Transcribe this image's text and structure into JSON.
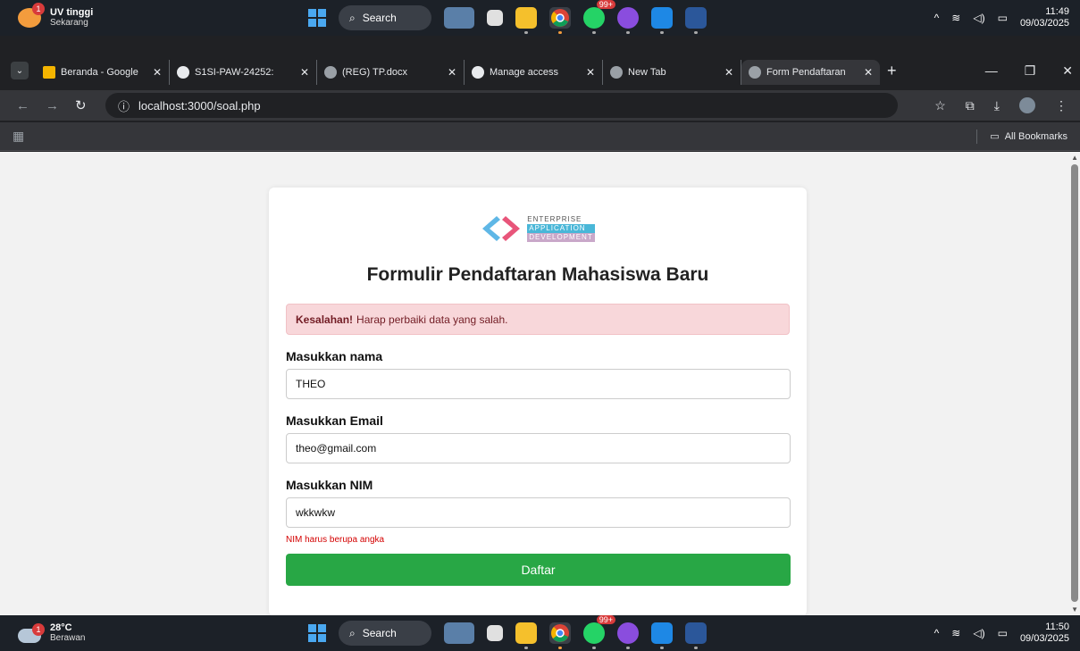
{
  "taskbar_top": {
    "notif_badge": "1",
    "notif_title": "UV tinggi",
    "notif_sub": "Sekarang",
    "search_label": "Search",
    "whatsapp_badge": "99+",
    "time": "11:49",
    "date": "09/03/2025"
  },
  "taskbar_bottom": {
    "weather_badge": "1",
    "temp": "28°C",
    "condition": "Berawan",
    "search_label": "Search",
    "whatsapp_badge": "99+",
    "time": "11:50",
    "date": "09/03/2025"
  },
  "tabs": [
    {
      "label": "Beranda - Google"
    },
    {
      "label": "S1SI-PAW-24252:"
    },
    {
      "label": "(REG) TP.docx"
    },
    {
      "label": "Manage access"
    },
    {
      "label": "New Tab"
    },
    {
      "label": "Form Pendaftaran"
    }
  ],
  "address": {
    "url": "localhost:3000/soal.php"
  },
  "bookmarks": {
    "all_label": "All Bookmarks"
  },
  "logo": {
    "line1": "ENTERPRISE",
    "line2": "APPLICATION",
    "line3": "DEVELOPMENT"
  },
  "form": {
    "title": "Formulir Pendaftaran Mahasiswa Baru",
    "alert_strong": "Kesalahan!",
    "alert_text": "Harap perbaiki data yang salah.",
    "name_label": "Masukkan nama",
    "name_value": "THEO",
    "email_label": "Masukkan Email",
    "email_value": "theo@gmail.com",
    "nim_label": "Masukkan NIM",
    "nim_value": "wkkwkw",
    "nim_error": "NIM harus berupa angka",
    "submit_label": "Daftar"
  },
  "colors": {
    "success": "#28a745",
    "alert_bg": "#f8d7da",
    "error_text": "#d40000"
  }
}
